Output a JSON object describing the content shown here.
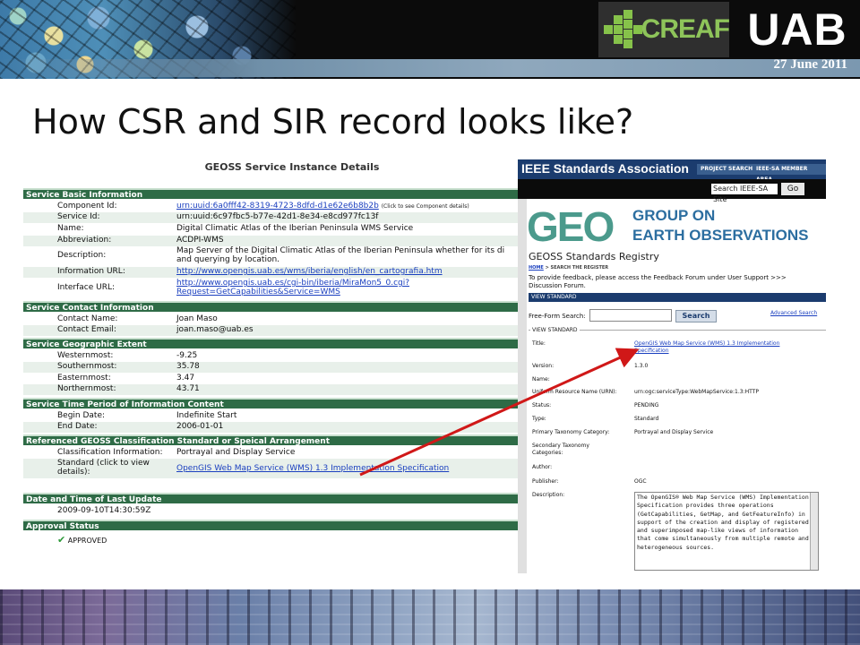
{
  "header": {
    "date": "27 June 2011",
    "logo_creaf": "CREAF",
    "logo_uab": "UAB"
  },
  "slide_title": "How CSR and SIR record looks like?",
  "geoss": {
    "title": "GEOSS Service Instance Details",
    "sections": {
      "basic": "Service Basic Information",
      "contact": "Service Contact Information",
      "extent": "Service Geographic Extent",
      "time": "Service Time Period of Information Content",
      "classification": "Referenced GEOSS Classification Standard or Speical Arrangement",
      "update": "Date and Time of Last Update",
      "approval": "Approval Status"
    },
    "rows": {
      "component_label": "Component Id:",
      "component_value": "urn:uuid:6a0fff42-8319-4723-8dfd-d1e62e6b8b2b",
      "component_note": "(Click to see Component details)",
      "service_id_label": "Service Id:",
      "service_id_value": "urn:uuid:6c97fbc5-b77e-42d1-8e34-e8cd977fc13f",
      "name_label": "Name:",
      "name_value": "Digital Climatic Atlas of the Iberian Peninsula WMS Service",
      "abbr_label": "Abbreviation:",
      "abbr_value": "ACDPI-WMS",
      "desc_label": "Description:",
      "desc_value": "Map Server of the Digital Climatic Atlas of the Iberian Peninsula whether for its di and querying by location.",
      "info_url_label": "Information URL:",
      "info_url_value": "http://www.opengis.uab.es/wms/iberia/english/en_cartografia.htm",
      "iface_url_label": "Interface URL:",
      "iface_url_value1": "http://www.opengis.uab.es/cgi-bin/iberia/MiraMon5_0.cgi?",
      "iface_url_value2": "Request=GetCapabilities&Service=WMS",
      "contact_name_label": "Contact Name:",
      "contact_name_value": "Joan Maso",
      "contact_email_label": "Contact Email:",
      "contact_email_value": "joan.maso@uab.es",
      "west_label": "Westernmost:",
      "west_value": "-9.25",
      "south_label": "Southernmost:",
      "south_value": "35.78",
      "east_label": "Easternmost:",
      "east_value": "3.47",
      "north_label": "Northernmost:",
      "north_value": "43.71",
      "begin_label": "Begin Date:",
      "begin_value": "Indefinite Start",
      "end_label": "End Date:",
      "end_value": "2006-01-01",
      "class_info_label": "Classification Information:",
      "class_info_value": "Portrayal and Display Service",
      "standard_label": "Standard (click to view details):",
      "standard_value": "OpenGIS Web Map Service (WMS) 1.3 Implementation Specification",
      "update_value": "2009-09-10T14:30:59Z",
      "approval_value": "APPROVED"
    }
  },
  "ieee": {
    "title": "IEEE Standards Association",
    "btn_project": "PROJECT SEARCH",
    "btn_member": "IEEE-SA MEMBER AREA",
    "search_placeholder": "Search IEEE-SA Site",
    "go": "Go"
  },
  "geo": {
    "logo": "GEO",
    "org_line1": "GROUP ON",
    "org_line2": "EARTH OBSERVATIONS",
    "registry_title": "GEOSS Standards Registry",
    "crumbs_home": "HOME",
    "crumbs_current": "SEARCH THE REGISTER",
    "feedback": "To provide feedback, please access the Feedback Forum under User Support >>> Discussion Forum.",
    "view_standard_bar": "VIEW STANDARD",
    "free_form_label": "Free-Form Search:",
    "search_button": "Search",
    "advanced_search": "Advanced Search",
    "view_standard_legend": "VIEW STANDARD",
    "fields": {
      "title_label": "Title:",
      "title_value": "OpenGIS Web Map Service (WMS) 1.3 Implementation Specification",
      "version_label": "Version:",
      "version_value": "1.3.0",
      "name_label": "Name:",
      "urn_label": "Uniform Resource Name (URN):",
      "urn_value": "urn:ogc:serviceType:WebMapService:1.3:HTTP",
      "status_label": "Status:",
      "status_value": "PENDING",
      "type_label": "Type:",
      "type_value": "Standard",
      "primary_label": "Primary Taxonomy Category:",
      "primary_value": "Portrayal and Display Service",
      "secondary_label": "Secondary Taxonomy Categories:",
      "author_label": "Author:",
      "publisher_label": "Publisher:",
      "publisher_value": "OGC",
      "description_label": "Description:",
      "description_value": "The OpenGIS® Web Map Service (WMS) Implementation Specification provides three operations (GetCapabilities, GetMap, and GetFeatureInfo) in support of the creation and display of registered and superimposed map-like views of information that come simultaneously from multiple remote and heterogeneous sources."
    }
  },
  "colors": {
    "section_green": "#2e6b46",
    "ieee_blue": "#1b3c6e",
    "arrow_red": "#d01818",
    "link_blue": "#1a3fbf"
  }
}
